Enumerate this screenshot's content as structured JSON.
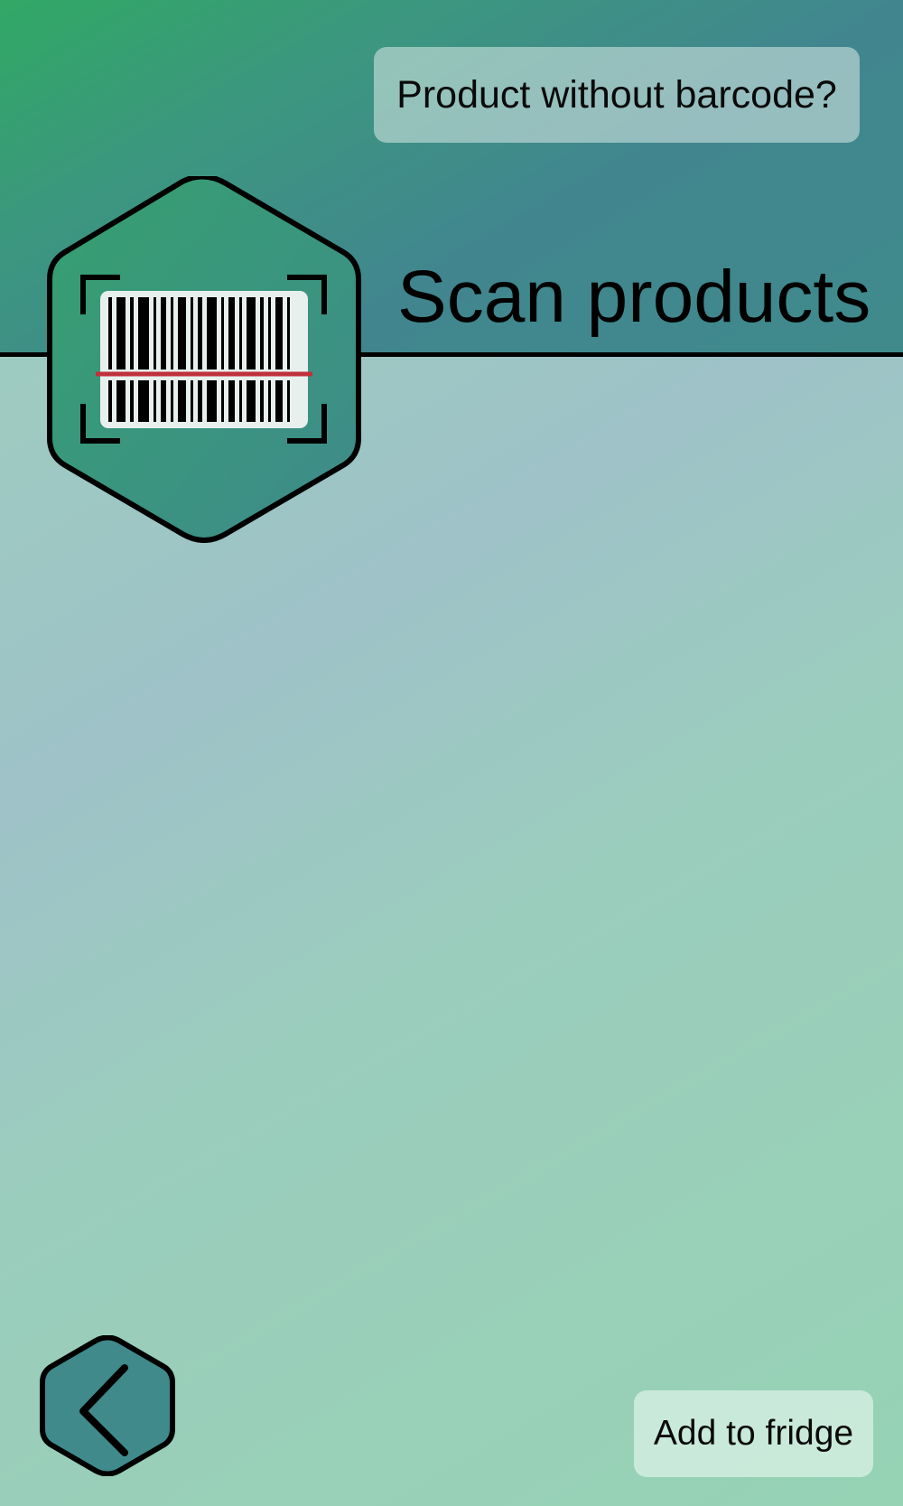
{
  "header": {
    "no_barcode_label": "Product without barcode?",
    "title": "Scan products"
  },
  "icons": {
    "logo": "barcode-scan-icon",
    "back": "chevron-left-icon"
  },
  "footer": {
    "add_label": "Add to fridge"
  },
  "colors": {
    "header_gradient_start": "#31a865",
    "header_gradient_end": "#408a8c",
    "body_gradient": "#9ec2c8",
    "hexagon_fill": "#3d9382",
    "back_button_fill": "#408a8c",
    "scan_line": "#c0303c"
  }
}
